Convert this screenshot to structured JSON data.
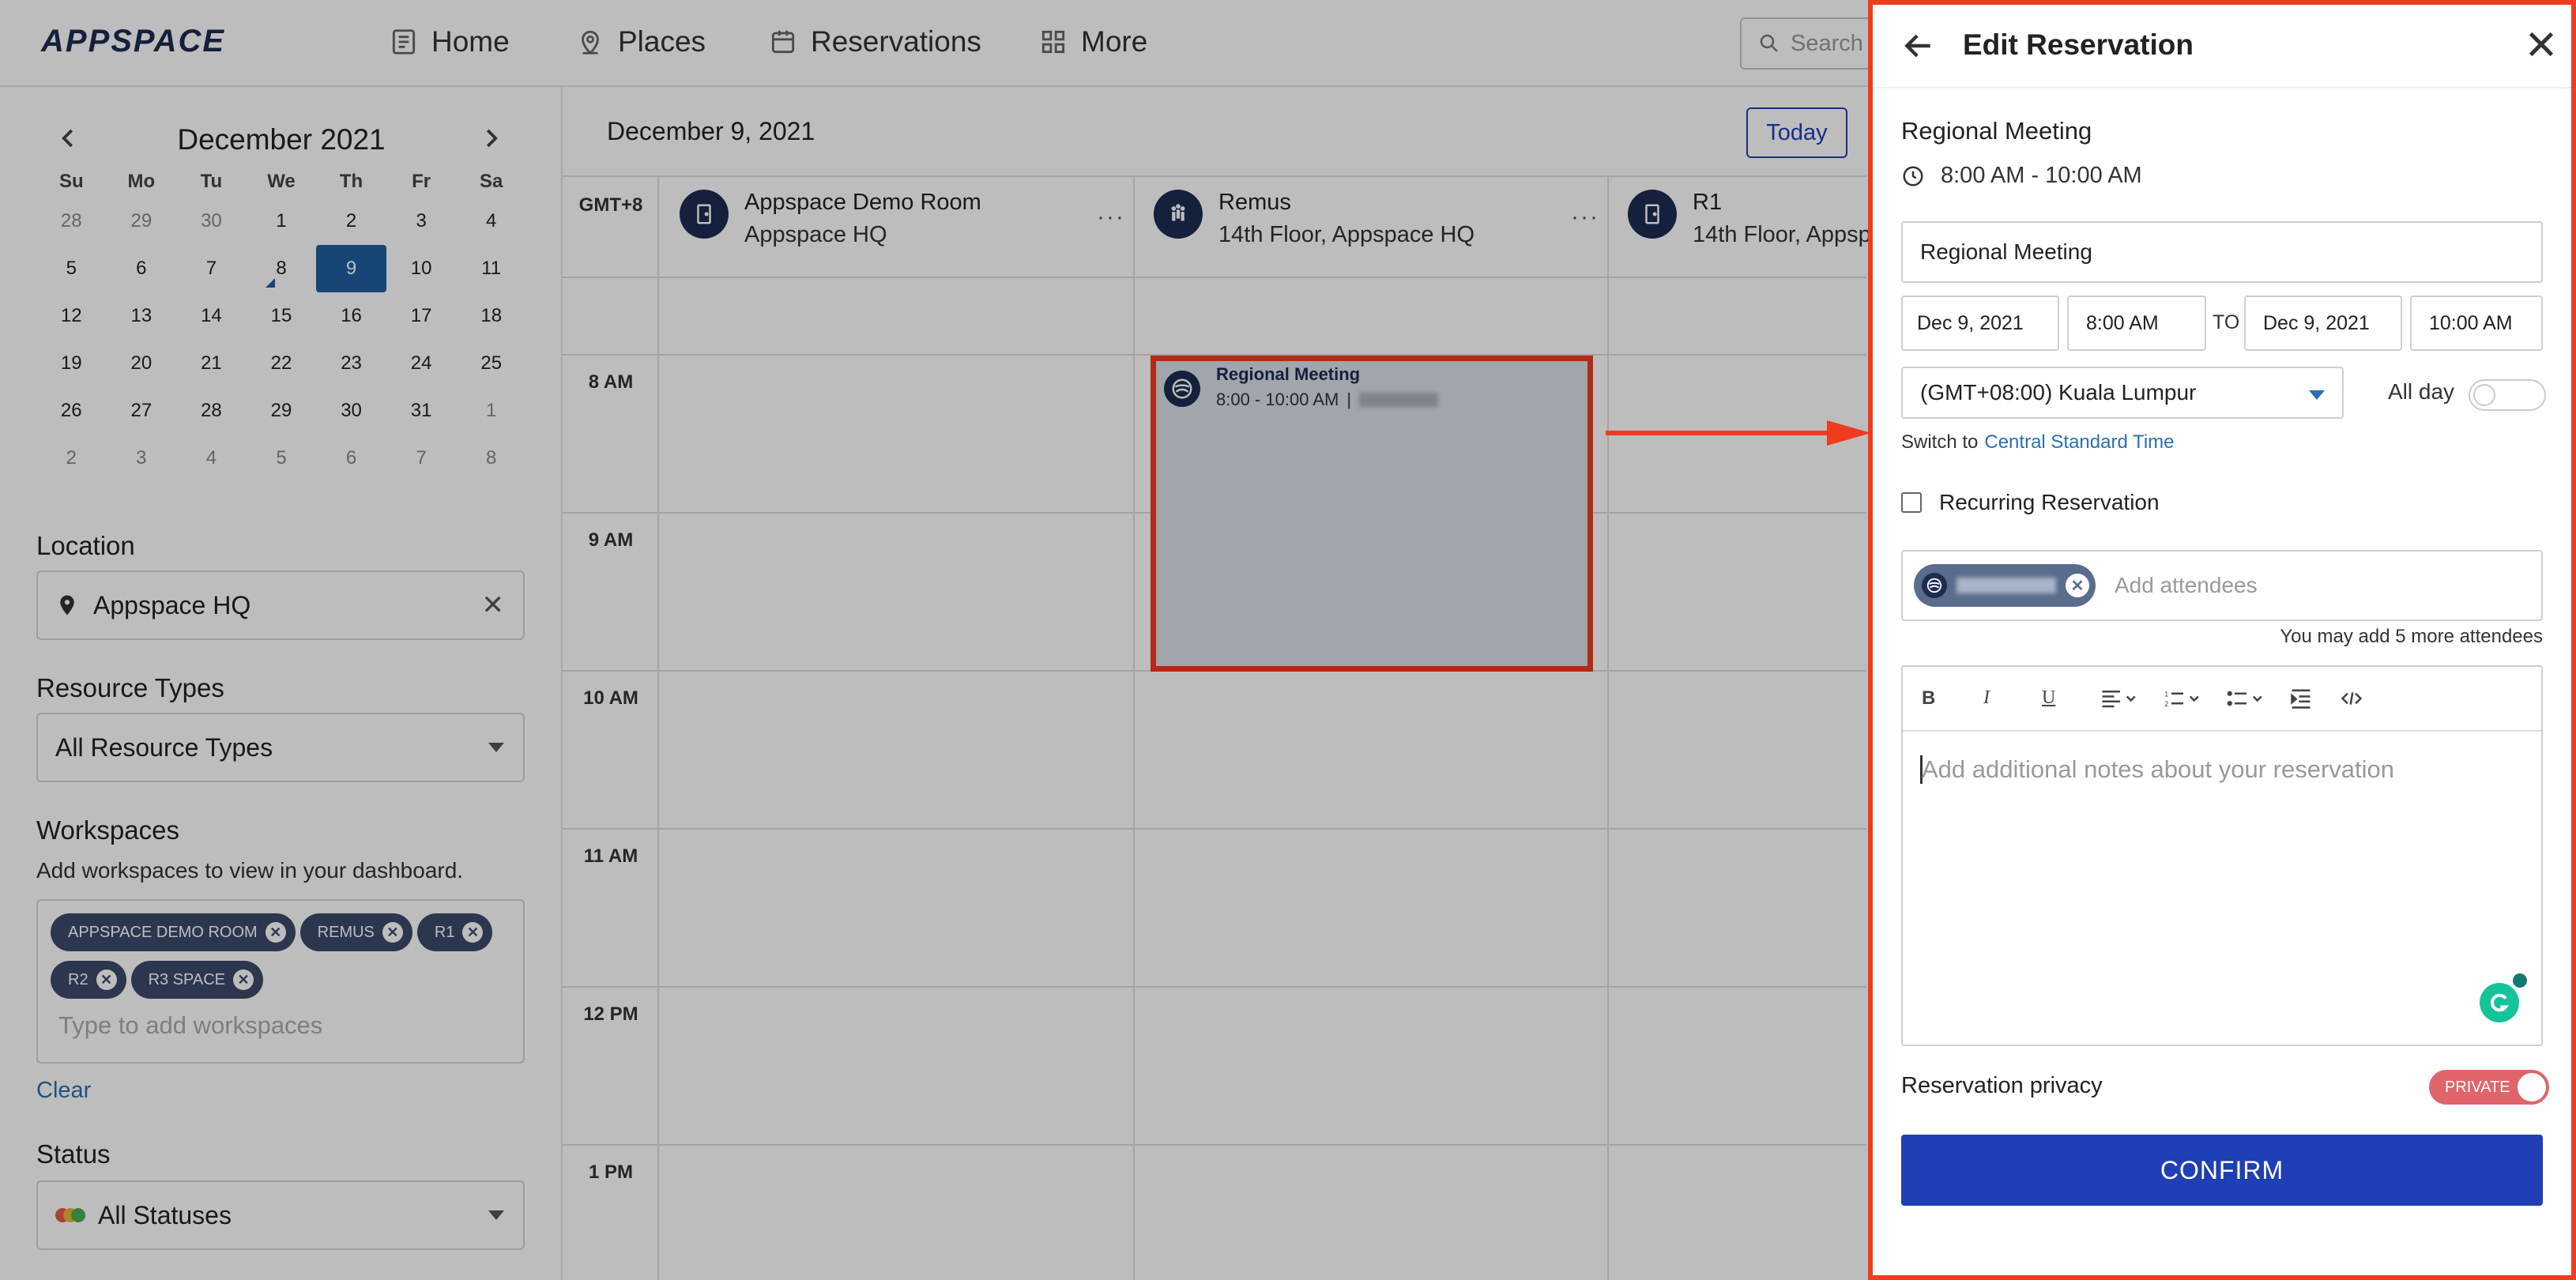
{
  "topnav": {
    "logo": "APPSPACE",
    "home": "Home",
    "places": "Places",
    "reservations": "Reservations",
    "more": "More",
    "search_placeholder": "Search p"
  },
  "mini_calendar": {
    "month": "December 2021",
    "weekdays": [
      "Su",
      "Mo",
      "Tu",
      "We",
      "Th",
      "Fr",
      "Sa"
    ],
    "weeks": [
      [
        "28",
        "29",
        "30",
        "1",
        "2",
        "3",
        "4"
      ],
      [
        "5",
        "6",
        "7",
        "8",
        "9",
        "10",
        "11"
      ],
      [
        "12",
        "13",
        "14",
        "15",
        "16",
        "17",
        "18"
      ],
      [
        "19",
        "20",
        "21",
        "22",
        "23",
        "24",
        "25"
      ],
      [
        "26",
        "27",
        "28",
        "29",
        "30",
        "31",
        "1"
      ],
      [
        "2",
        "3",
        "4",
        "5",
        "6",
        "7",
        "8"
      ]
    ],
    "selected_day": "9"
  },
  "filters": {
    "location_label": "Location",
    "location_value": "Appspace HQ",
    "resource_label": "Resource Types",
    "resource_value": "All Resource Types",
    "workspaces_label": "Workspaces",
    "workspaces_hint": "Add workspaces to view in your dashboard.",
    "workspace_chips": [
      "APPSPACE DEMO ROOM",
      "REMUS",
      "R1",
      "R2",
      "R3 SPACE"
    ],
    "workspaces_placeholder": "Type to add workspaces",
    "clear": "Clear",
    "status_label": "Status",
    "status_value": "All Statuses"
  },
  "calendar": {
    "date_title": "December 9, 2021",
    "today_button": "Today",
    "timezone": "GMT+8",
    "columns": [
      {
        "name": "Appspace Demo Room",
        "sub": "Appspace HQ"
      },
      {
        "name": "Remus",
        "sub": "14th Floor, Appspace HQ"
      },
      {
        "name": "R1",
        "sub": "14th Floor, Appspa"
      }
    ],
    "hours": [
      "8 AM",
      "9 AM",
      "10 AM",
      "11 AM",
      "12 PM",
      "1 PM"
    ],
    "event": {
      "title": "Regional Meeting",
      "time": "8:00 - 10:00 AM",
      "separator": "|"
    }
  },
  "drawer": {
    "title": "Edit Reservation",
    "summary_title": "Regional Meeting",
    "summary_time": "8:00 AM - 10:00 AM",
    "name_value": "Regional Meeting",
    "start_date": "Dec 9, 2021",
    "start_time": "8:00 AM",
    "to_label": "TO",
    "end_date": "Dec 9, 2021",
    "end_time": "10:00 AM",
    "timezone_value": "(GMT+08:00) Kuala Lumpur",
    "all_day": "All day",
    "switch_to": "Switch to",
    "switch_link": "Central Standard Time",
    "recurring": "Recurring Reservation",
    "attendees_placeholder": "Add attendees",
    "attendees_hint": "You may add 5 more attendees",
    "toolbar": {
      "bold": "B",
      "italic": "I",
      "underline": "U"
    },
    "notes_placeholder": "Add additional notes about your reservation",
    "privacy_label": "Reservation privacy",
    "privacy_toggle": "PRIVATE",
    "confirm": "CONFIRM"
  },
  "colors": {
    "accent": "#1f3fb5",
    "highlight": "#ef3b1e",
    "private_toggle": "#e0656b",
    "link": "#2a6fb0"
  }
}
